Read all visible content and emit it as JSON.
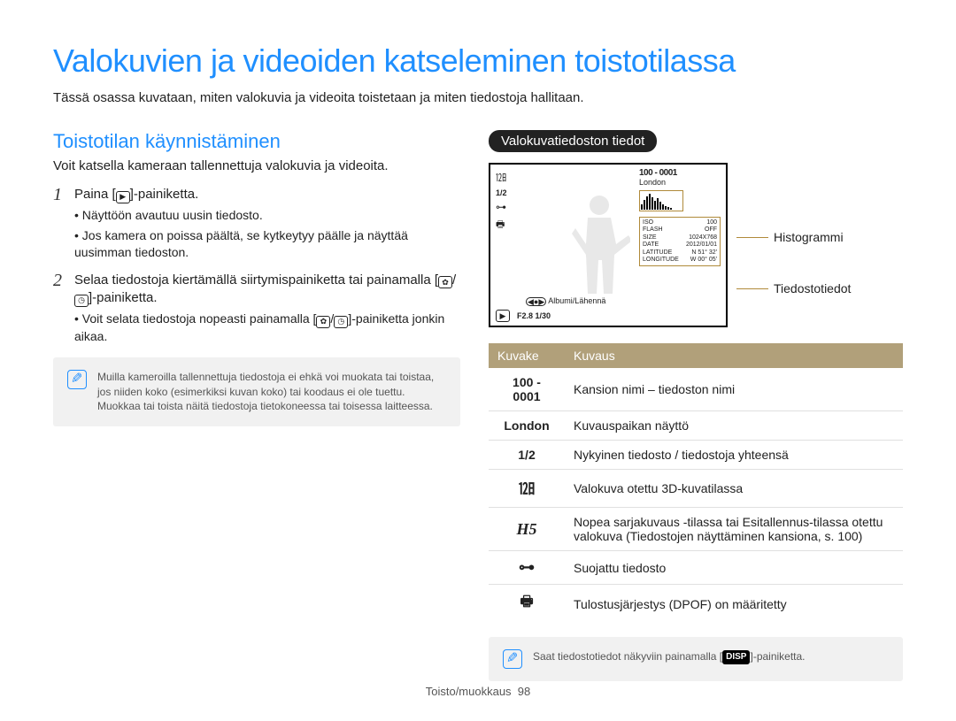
{
  "title": "Valokuvien ja videoiden katseleminen toistotilassa",
  "intro": "Tässä osassa kuvataan, miten valokuvia ja videoita toistetaan ja miten tiedostoja hallitaan.",
  "left": {
    "section": "Toistotilan käynnistäminen",
    "lead": "Voit katsella kameraan tallennettuja valokuvia ja videoita.",
    "step1_pre": "Paina [",
    "step1_post": "]-painiketta.",
    "step1_sub1": "Näyttöön avautuu uusin tiedosto.",
    "step1_sub2": "Jos kamera on poissa päältä, se kytkeytyy päälle ja näyttää uusimman tiedoston.",
    "step2": "Selaa tiedostoja kiertämällä siirtymispainiketta tai painamalla [",
    "step2_post": "]-painiketta.",
    "step2_sub_pre": "Voit selata tiedostoja nopeasti painamalla [",
    "step2_sub_post": "]-painiketta jonkin aikaa.",
    "note": "Muilla kameroilla tallennettuja tiedostoja ei ehkä voi muokata tai toistaa, jos niiden koko (esimerkiksi kuvan koko) tai koodaus ei ole tuettu. Muokkaa tai toista näitä tiedostoja tietokoneessa tai toisessa laitteessa."
  },
  "right": {
    "pill": "Valokuvatiedoston tiedot",
    "callout_histogram": "Histogrammi",
    "callout_fileinfo": "Tiedostotiedot",
    "screen": {
      "counter": "1/2",
      "folder_file": "100 - 0001",
      "location": "London",
      "meta": [
        {
          "k": "ISO",
          "v": "100"
        },
        {
          "k": "FLASH",
          "v": "OFF"
        },
        {
          "k": "SIZE",
          "v": "1024X768"
        },
        {
          "k": "DATE",
          "v": "2012/01/01"
        },
        {
          "k": "LATITUDE",
          "v": "N 51° 32'"
        },
        {
          "k": "LONGITUDE",
          "v": "W 00° 05'"
        }
      ],
      "album_label": "Albumi/Lähennä",
      "bottom": "F2.8 1/30"
    },
    "table": {
      "head_icon": "Kuvake",
      "head_desc": "Kuvaus",
      "rows": [
        {
          "icon_text": "100 - 0001",
          "desc": "Kansion nimi – tiedoston nimi"
        },
        {
          "icon_text": "London",
          "desc": "Kuvauspaikan näyttö"
        },
        {
          "icon_text": "1/2",
          "desc": "Nykyinen tiedosto / tiedostoja yhteensä"
        },
        {
          "icon_class": "ic-3d",
          "desc": "Valokuva otettu 3D-kuvatilassa"
        },
        {
          "icon_class": "ic-h5",
          "icon_text": "H5",
          "desc": "Nopea sarjakuvaus -tilassa tai Esitallennus-tilassa otettu valokuva (Tiedostojen näyttäminen kansiona, s. 100)"
        },
        {
          "icon_class": "ic-key",
          "desc": "Suojattu tiedosto"
        },
        {
          "icon_class": "ic-print",
          "desc": "Tulostusjärjestys (DPOF) on määritetty"
        }
      ]
    },
    "note_pre": "Saat tiedostotiedot näkyviin painamalla [",
    "note_disp": "DISP",
    "note_post": "]-painiketta."
  },
  "footer": {
    "section": "Toisto/muokkaus",
    "page": "98"
  }
}
